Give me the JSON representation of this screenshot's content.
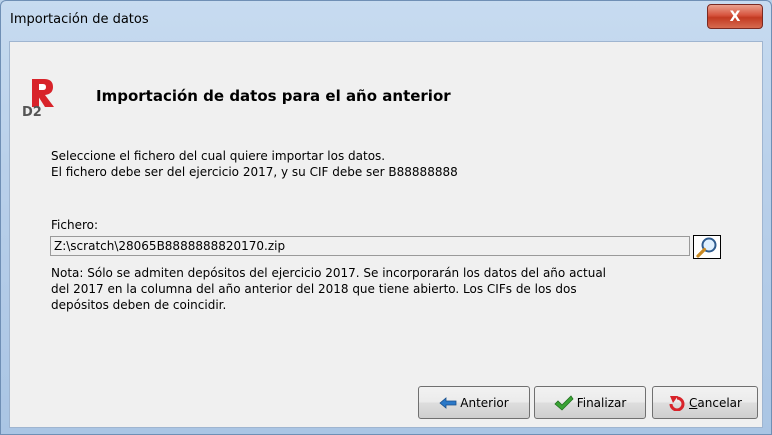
{
  "window": {
    "title": "Importación de datos",
    "close_glyph": "X"
  },
  "header": {
    "logo": {
      "icon": "d2-logo-icon",
      "text": "D2"
    },
    "title": "Importación de datos para el año anterior"
  },
  "instructions": {
    "line1": "Seleccione el fichero del cual quiere importar los datos.",
    "line2": "El fichero debe ser del ejercicio 2017, y su CIF debe ser B88888888"
  },
  "file": {
    "label": "Fichero:",
    "value": "Z:\\scratch\\28065B8888888820170.zip",
    "browse_icon": "magnifier-icon"
  },
  "note": {
    "line1": "Nota: Sólo se admiten depósitos del ejercicio 2017. Se incorporarán los datos del año actual",
    "line2": "del 2017 en la columna del año anterior del 2018 que tiene abierto. Los CIFs de los dos",
    "line3": "depósitos deben de coincidir."
  },
  "buttons": {
    "anterior": {
      "label": "Anterior",
      "icon": "arrow-left-icon"
    },
    "finalizar": {
      "label": "Finalizar",
      "icon": "checkmark-icon"
    },
    "cancelar": {
      "label": "Cancelar",
      "icon": "cancel-undo-icon"
    }
  },
  "colors": {
    "logo_red": "#d8232a",
    "close_red": "#c23a22",
    "arrow_blue": "#2a78c8",
    "check_green": "#3aa335"
  }
}
